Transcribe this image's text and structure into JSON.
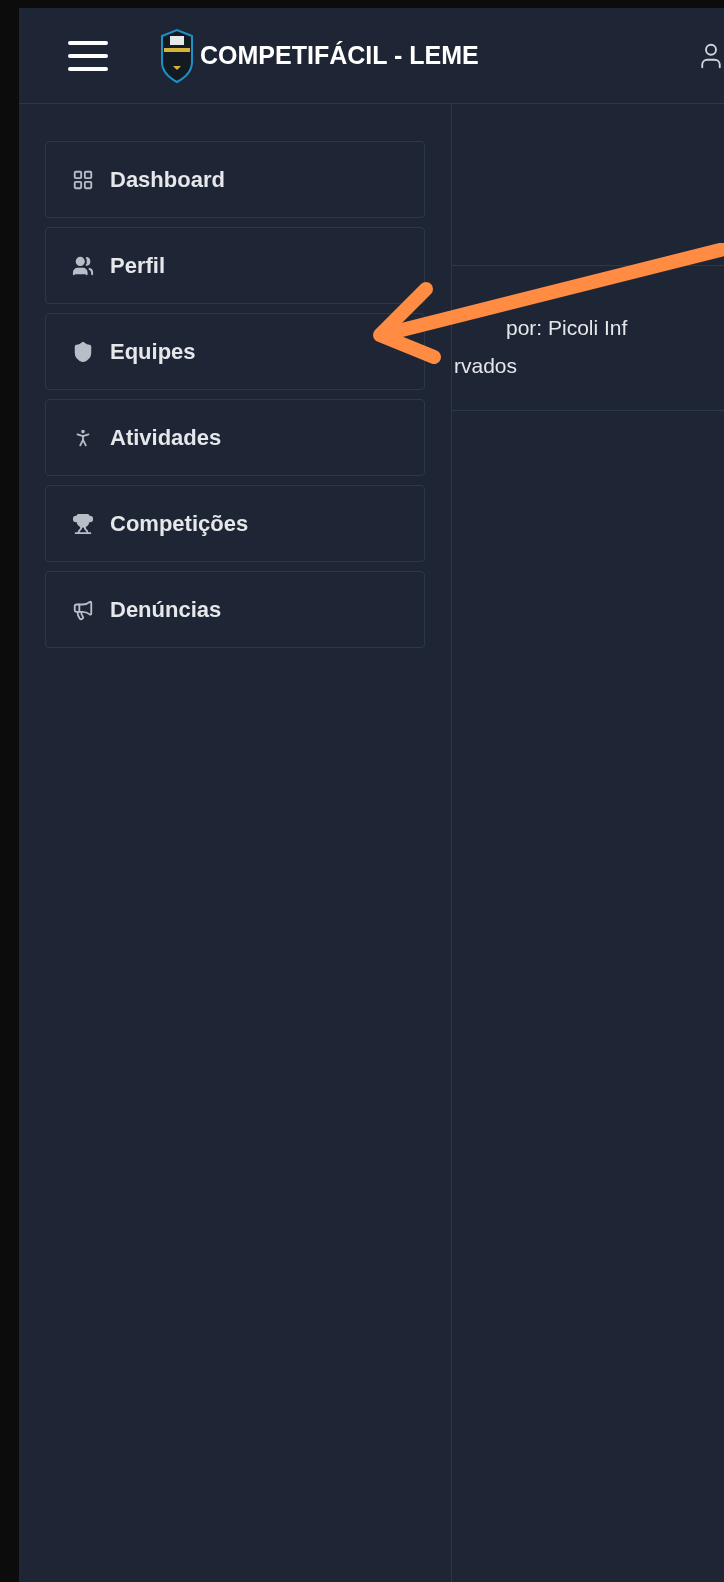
{
  "header": {
    "title": "COMPETIFÁCIL - LEME"
  },
  "sidebar": {
    "items": [
      {
        "label": "Dashboard"
      },
      {
        "label": "Perfil"
      },
      {
        "label": "Equipes"
      },
      {
        "label": "Atividades"
      },
      {
        "label": "Competições"
      },
      {
        "label": "Denúncias"
      }
    ]
  },
  "footer": {
    "lines": [
      "por: Picoli Inf",
      "rvados"
    ]
  }
}
